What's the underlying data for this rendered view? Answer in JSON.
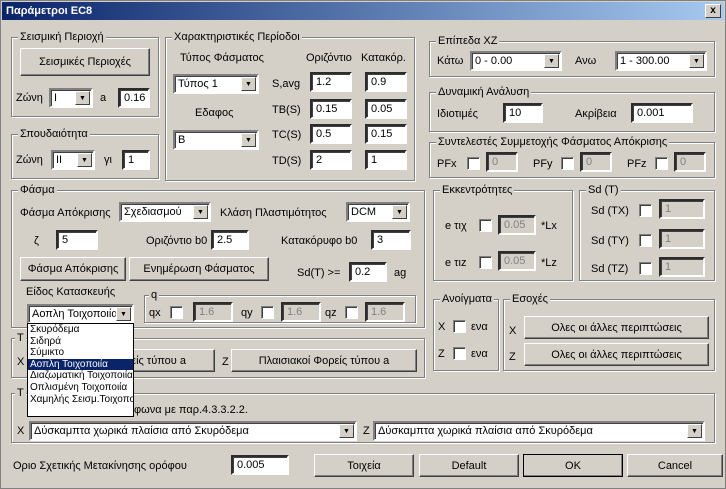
{
  "window": {
    "title": "Παράμετροι EC8",
    "close": "x"
  },
  "seismic_region": {
    "title": "Σεισμική Περιοχή",
    "button": "Σεισμικές Περιοχές",
    "zone_label": "Ζώνη",
    "zone_value": "I",
    "a_label": "a",
    "a_value": "0.16"
  },
  "importance": {
    "title": "Σπουδαιότητα",
    "zone_label": "Ζώνη",
    "zone_value": "II",
    "gamma_label": "γι",
    "gamma_value": "1"
  },
  "periods": {
    "title": "Χαρακτηριστικές Περίοδοι",
    "spectrum_type_label": "Τύπος Φάσματος",
    "col_horizontal": "Οριζόντιο",
    "col_vertical": "Κατακόρ.",
    "spectrum_type_value": "Τύπος 1",
    "soil_label": "Εδαφος",
    "soil_value": "B",
    "rows": [
      {
        "label": "S,avg",
        "h": "1.2",
        "v": "0.9"
      },
      {
        "label": "TB(S)",
        "h": "0.15",
        "v": "0.05"
      },
      {
        "label": "TC(S)",
        "h": "0.5",
        "v": "0.15"
      },
      {
        "label": "TD(S)",
        "h": "2",
        "v": "1"
      }
    ]
  },
  "xz_levels": {
    "title": "Επίπεδα XZ",
    "lower_label": "Κάτω",
    "lower_value": "0 - 0.00",
    "upper_label": "Ανω",
    "upper_value": "1 - 300.00"
  },
  "dynamic": {
    "title": "Δυναμική Ανάλυση",
    "modes_label": "Ιδιοτιμές",
    "modes_value": "10",
    "accuracy_label": "Ακρίβεια",
    "accuracy_value": "0.001"
  },
  "participation": {
    "title": "Συντελεστές Συμμετοχής Φάσματος Απόκρισης",
    "pfx": "PFx",
    "pfx_value": "0",
    "pfy": "PFy",
    "pfy_value": "0",
    "pfz": "PFz",
    "pfz_value": "0"
  },
  "spectrum": {
    "title": "Φάσμα",
    "response_label": "Φάσμα Απόκρισης",
    "response_value": "Σχεδιασμού",
    "ductility_label": "Κλάση Πλαστιμότητος",
    "ductility_value": "DCM",
    "zeta_label": "ζ",
    "zeta_value": "5",
    "horiz_b0_label": "Οριζόντιο b0",
    "horiz_b0_value": "2.5",
    "vert_b0_label": "Κατακόρυφο b0",
    "vert_b0_value": "3",
    "response_button": "Φάσμα Απόκρισης",
    "update_button": "Ενημέρωση Φάσματος",
    "sd_label": "Sd(T) >=",
    "sd_value": "0.2",
    "sd_unit": "ag",
    "structure_label": "Είδος Κατασκευής",
    "structure_value": "Αοπλη Τοιχοποιία",
    "q_label": "q",
    "qx": "qx",
    "qx_value": "1.6",
    "qy": "qy",
    "qy_value": "1.6",
    "qz": "qz",
    "qz_value": "1.6"
  },
  "structure_options": [
    "Σκυρόδεμα",
    "Σιδηρά",
    "Σύμικτο",
    "Αοπλη Τοιχοποιία",
    "Διαζωματική Τοιχοποιία",
    "Οπλισμένη Τοιχοποιία",
    "Χαμηλής Σεισμ.Τοιχοποιία"
  ],
  "eccentricity": {
    "title": "Εκκεντρότητες",
    "etx_label": "e τιχ",
    "etx_value": "0.05",
    "etx_unit": "*Lx",
    "etz_label": "e τιz",
    "etz_value": "0.05",
    "etz_unit": "*Lz"
  },
  "sdt": {
    "title": "Sd (T)",
    "tx_label": "Sd (TX)",
    "tx_value": "1",
    "ty_label": "Sd (TY)",
    "ty_value": "1",
    "tz_label": "Sd (TZ)",
    "tz_value": "1"
  },
  "openings": {
    "title": "Ανοίγματα",
    "x_label": "X",
    "x_text": "ενα",
    "z_label": "Z",
    "z_text": "ενα"
  },
  "recesses": {
    "title": "Εσοχές",
    "x_label": "X",
    "x_button": "Ολες οι άλλες περιπτώσεις",
    "z_label": "Z",
    "z_button": "Ολες οι άλλες περιπτώσεις"
  },
  "frame_types": {
    "title_fragment": "Τ",
    "x_label": "X",
    "x_button": "ρείς τύπου a",
    "z_label": "Z",
    "z_button": "Πλαισιακοί Φορείς τύπου a"
  },
  "types2": {
    "title_fragment": "Τ",
    "text": "φωνα με παρ.4.3.3.2.2.",
    "x_label": "X",
    "x_value": "Δύσκαμπτα χωρικά πλαίσια από Σκυρόδεμα",
    "z_label": "Z",
    "z_value": "Δύσκαμπτα χωρικά πλαίσια από Σκυρόδεμα"
  },
  "footer": {
    "drift_label": "Οριο Σχετικής Μετακίνησης ορόφου",
    "drift_value": "0.005",
    "walls_button": "Τοιχεία",
    "default_button": "Default",
    "ok_button": "OK",
    "cancel_button": "Cancel"
  }
}
